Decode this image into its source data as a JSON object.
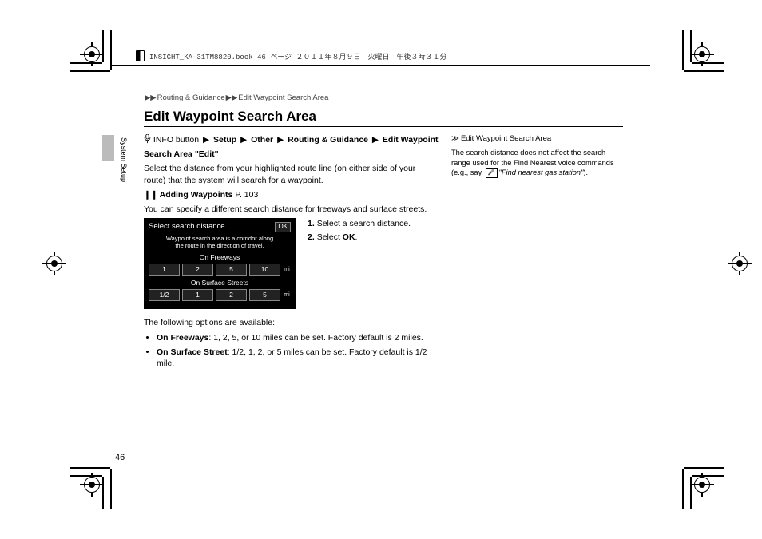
{
  "header": {
    "file_info": "INSIGHT_KA-31TM8820.book  46 ページ  ２０１１年８月９日　火曜日　午後３時３１分"
  },
  "breadcrumb": {
    "sep": "▶▶",
    "a": "Routing & Guidance",
    "b": "Edit Waypoint Search Area"
  },
  "title": "Edit Waypoint Search Area",
  "section_tab": "System Setup",
  "path": {
    "pre": "INFO button",
    "sep": "▶",
    "p1": "Setup",
    "p2": "Other",
    "p3": "Routing & Guidance",
    "p4_a": "Edit Waypoint",
    "p4_b": "Search Area \"Edit\""
  },
  "intro": "Select the distance from your highlighted route line (on either side of your route) that the system will search for a waypoint.",
  "xref": {
    "icon": "❙❙",
    "label": "Adding Waypoints",
    "page": "P. 103"
  },
  "spec_line": "You can specify a different search distance for freeways and surface streets.",
  "device": {
    "title": "Select search distance",
    "ok": "OK",
    "sub1": "Waypoint search area is a corridor along",
    "sub2": "the route in the direction of travel.",
    "grp1": "On Freeways",
    "fwy": [
      "1",
      "2",
      "5",
      "10"
    ],
    "grp2": "On Surface Streets",
    "sfc": [
      "1/2",
      "1",
      "2",
      "5"
    ],
    "unit": "mi"
  },
  "steps": {
    "s1_num": "1.",
    "s1": "Select a search distance.",
    "s2_num": "2.",
    "s2_pre": "Select ",
    "s2_strong": "OK",
    "s2_post": "."
  },
  "options_intro": "The following options are available:",
  "opt1": {
    "label": "On Freeways",
    "text": ": 1, 2, 5, or 10 miles can be set. Factory default is 2 miles."
  },
  "opt2": {
    "label": "On Surface Street",
    "text": ": 1/2, 1, 2, or 5 miles can be set. Factory default is 1/2 mile."
  },
  "sidebar": {
    "arrow": "≫",
    "title": "Edit Waypoint Search Area",
    "body_a": "The search distance does not affect the search range used for the Find Nearest voice commands (e.g., say ",
    "voice_icon": "🎤",
    "body_quote": "\"Find nearest gas station\"",
    "body_b": ")."
  },
  "page_number": "46"
}
